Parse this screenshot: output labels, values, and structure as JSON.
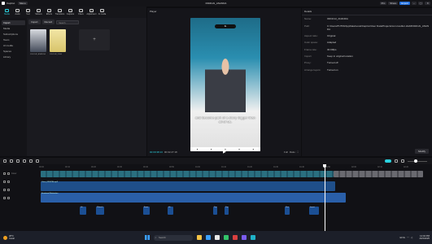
{
  "app": {
    "name": "CapCut",
    "menu_label": "Menu",
    "project_name": "0304CAI_ANANDA",
    "top_actions": [
      "Pro",
      "Share",
      "Export"
    ]
  },
  "toolbar": {
    "items": [
      {
        "label": "Media",
        "icon": "media-icon",
        "active": true
      },
      {
        "label": "Audio",
        "icon": "audio-icon"
      },
      {
        "label": "Text",
        "icon": "text-icon"
      },
      {
        "label": "Stickers",
        "icon": "sticker-icon"
      },
      {
        "label": "Effects",
        "icon": "effects-icon"
      },
      {
        "label": "Transitions",
        "icon": "transitions-icon"
      },
      {
        "label": "Captions",
        "icon": "captions-icon"
      },
      {
        "label": "Filters",
        "icon": "filters-icon"
      },
      {
        "label": "Adjustment",
        "icon": "adjust-icon"
      },
      {
        "label": "AI media",
        "icon": "ai-icon"
      }
    ]
  },
  "leftnav": {
    "items": [
      {
        "label": "Import",
        "active": true
      },
      {
        "label": "Media"
      },
      {
        "label": "Subscriptions"
      },
      {
        "label": "Team"
      },
      {
        "label": "AI media"
      },
      {
        "label": "Spaces"
      },
      {
        "label": "Library"
      }
    ]
  },
  "media": {
    "import_label": "Import",
    "record_label": "Record",
    "search_placeholder": "Search",
    "items": [
      {
        "caption": "0304CAI_ANANDA"
      },
      {
        "caption": "0304CAI_IDEA"
      }
    ],
    "add_symbol": "+"
  },
  "player": {
    "title": "Player",
    "caption_text": "and become part of a story bigger than all of us.",
    "time_current": "00:00:38:13",
    "time_total": "00:02:27:18",
    "play_symbol": "▶",
    "controls": [
      "Full",
      "Ratio",
      "⛶"
    ]
  },
  "details": {
    "title": "Details",
    "rows": [
      {
        "key": "Name:",
        "value": "0304CAI_ANANDA"
      },
      {
        "key": "Path:",
        "value": "C:/Users/PUTRI/AppData/Local/CapCut/User Data/Projects/com.lveditor.draft/0304CAI_ANANDA"
      },
      {
        "key": "Aspect ratio:",
        "value": "Original"
      },
      {
        "key": "Color space:",
        "value": "Adapted"
      },
      {
        "key": "Frame rate:",
        "value": "30.00fps"
      },
      {
        "key": "Import:",
        "value": "Keep in original location"
      },
      {
        "key": "Proxy:",
        "value": "Turned off"
      },
      {
        "key": "Arrange layers:",
        "value": "Turned on"
      }
    ],
    "modify_label": "Modify"
  },
  "timeline": {
    "ruler_marks": [
      "00:00",
      "00:10",
      "00:20",
      "00:30",
      "00:40",
      "00:50",
      "01:00",
      "01:10",
      "01:20",
      "01:30",
      "01:40",
      "01:50",
      "02:00",
      "02:10",
      "02:20"
    ],
    "tracks": [
      {
        "label": "Cover"
      },
      {
        "label": ""
      },
      {
        "label": ""
      },
      {
        "label": ""
      },
      {
        "label": ""
      }
    ],
    "audio1_label": "Voice_0304CAI.mp3",
    "audio2_label": "Emotional Motivation",
    "sfx": [
      {
        "label": "Hit"
      },
      {
        "label": "Whoosh"
      },
      {
        "label": "Boom"
      },
      {
        "label": "Hit"
      },
      {
        "label": "Pop"
      },
      {
        "label": "Pop"
      },
      {
        "label": "Rise"
      },
      {
        "label": "Impact"
      }
    ]
  },
  "taskbar": {
    "weather_temp": "28°C",
    "weather_desc": "Cerah",
    "search_placeholder": "Search",
    "time": "12:04 PM",
    "date": "26/3/2025",
    "lang": "ENG"
  }
}
